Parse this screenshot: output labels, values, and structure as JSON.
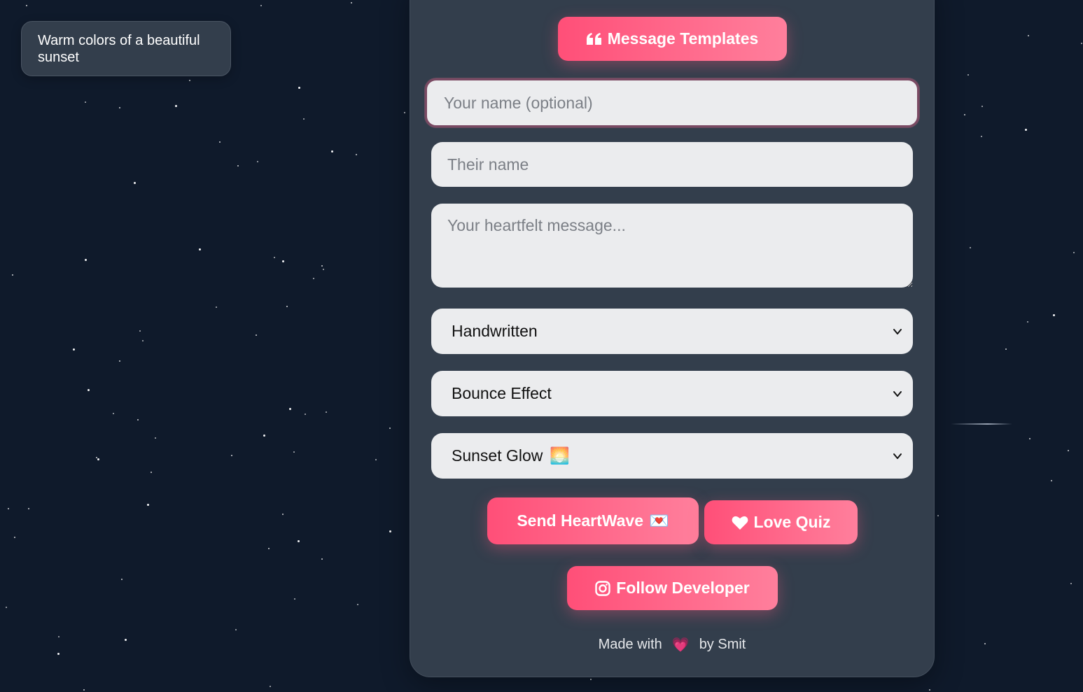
{
  "tooltip": {
    "text": "Warm colors of a beautiful sunset"
  },
  "templates_button": {
    "label": "Message Templates",
    "icon": "quote-icon"
  },
  "form": {
    "your_name": {
      "placeholder": "Your name (optional)",
      "value": ""
    },
    "their_name": {
      "placeholder": "Their name",
      "value": ""
    },
    "message": {
      "placeholder": "Your heartfelt message...",
      "value": ""
    },
    "font_select": {
      "selected": "Handwritten"
    },
    "animation_select": {
      "selected": "Bounce Effect"
    },
    "theme_select": {
      "selected": "Sunset Glow",
      "emoji": "🌅"
    }
  },
  "actions": {
    "send": {
      "label": "Send HeartWave",
      "emoji": "💌"
    },
    "quiz": {
      "label": "Love Quiz",
      "icon": "heart-icon"
    },
    "follow": {
      "label": "Follow Developer",
      "icon": "instagram-icon"
    }
  },
  "footer": {
    "prefix": "Made with",
    "emoji": "💗",
    "suffix": "by Smit"
  },
  "colors": {
    "background": "#0f1a2b",
    "card": "#333e4c",
    "accent_start": "#ff4f78",
    "accent_end": "#ff7f9c",
    "field": "#ebecee"
  }
}
